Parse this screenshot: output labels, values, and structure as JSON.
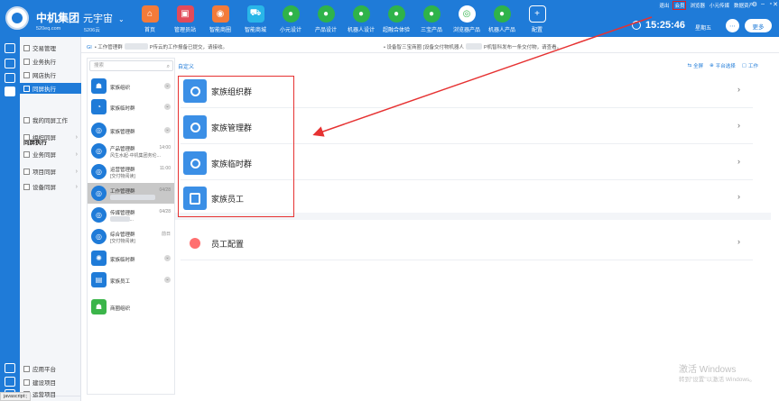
{
  "header": {
    "brand": "中机集团",
    "brand_url": "520eq.com",
    "universe": "元宇宙",
    "universe_sub": "5206云",
    "nav": [
      {
        "label": "首页",
        "icon": "home-icon",
        "color": "#f37b3a",
        "glyph": "⌂"
      },
      {
        "label": "管理员站",
        "icon": "admin-icon",
        "color": "#e24b5a",
        "glyph": "▣"
      },
      {
        "label": "智能商圈",
        "icon": "business-circle-icon",
        "color": "#f37b3a",
        "glyph": "◉"
      },
      {
        "label": "智能商城",
        "icon": "cart-icon",
        "color": "#29b6e8",
        "glyph": "⛟"
      },
      {
        "label": "小元设计",
        "icon": "design-icon",
        "color": "#2fb34a",
        "glyph": "●"
      },
      {
        "label": "产品设计",
        "icon": "product-icon",
        "color": "#2fb34a",
        "glyph": "●"
      },
      {
        "label": "机器人设计",
        "icon": "robot-design-icon",
        "color": "#2fb34a",
        "glyph": "●"
      },
      {
        "label": "超融合体验",
        "icon": "fusion-icon",
        "color": "#2fb34a",
        "glyph": "●"
      },
      {
        "label": "三宝产品",
        "icon": "sanbao-icon",
        "color": "#2fb34a",
        "glyph": "●"
      },
      {
        "label": "浏览器产品",
        "icon": "browser-icon",
        "color": "#ffffff",
        "glyph": "◎"
      },
      {
        "label": "机器人产品",
        "icon": "robot-product-icon",
        "color": "#2fb34a",
        "glyph": "●"
      },
      {
        "label": "配置",
        "icon": "plus-icon",
        "color": "#1f7bd8",
        "glyph": "+"
      }
    ],
    "links": {
      "exit": "退出",
      "vip": "会员",
      "browser": "浏览器",
      "helper": "小元传媒",
      "assets": "数据资产"
    },
    "clock": "15:25:46",
    "weekday": "星期五",
    "more": "更多"
  },
  "leftmenu": {
    "top_items": [
      "交易管理",
      "业务执行",
      "网店执行",
      "同屏执行"
    ],
    "head": "同屏执行",
    "items": [
      {
        "label": "我的同屏工作",
        "arrow": ""
      },
      {
        "label": "组织同屏",
        "arrow": "›"
      },
      {
        "label": "业务同屏",
        "arrow": "›"
      },
      {
        "label": "项目同屏",
        "arrow": "›"
      },
      {
        "label": "设备同屏",
        "arrow": "›"
      }
    ],
    "bottom_items": [
      "应用平台",
      "建设项目",
      "运营项目"
    ]
  },
  "notices": {
    "prefix": "GI",
    "n1a": "• 工作管理群",
    "n1b": "P传云的工作报备已提交，请接收。",
    "n2a": "• 设备智三宝商圈 [设备交付物机器人",
    "n2b": "P机智科发布一条交付物，请查看。"
  },
  "contacts": {
    "search_placeholder": "搜索",
    "items": [
      {
        "name": "家族组织",
        "sub": "",
        "time": "",
        "avatar": "org-icon",
        "glyph": "☗",
        "square": true
      },
      {
        "name": "家族临时群",
        "sub": "",
        "time": "",
        "avatar": "temp-group-icon",
        "glyph": "◔",
        "square": true
      },
      {
        "name": "家族管理群",
        "sub": "",
        "time": "",
        "avatar": "manage-group-icon",
        "glyph": "◎",
        "square": false
      },
      {
        "name": "产品管理群",
        "sub": "风生水起-中机集团务伦...",
        "time": "14:00",
        "avatar": "product-group-icon",
        "glyph": "◎",
        "square": false
      },
      {
        "name": "运营管理群",
        "sub": "[交付物阅读]",
        "time": "11:00",
        "avatar": "ops-group-icon",
        "glyph": "◎",
        "square": false
      },
      {
        "name": "工作管理群",
        "sub": "",
        "time": "04/28",
        "avatar": "work-group-icon",
        "glyph": "◎",
        "square": false
      },
      {
        "name": "传媒管理群",
        "sub": "云(平台交...",
        "time": "04/28",
        "avatar": "media-group-icon",
        "glyph": "◎",
        "square": false
      },
      {
        "name": "综合管理群",
        "sub": "[交付物阅读]",
        "time": "前日",
        "avatar": "general-group-icon",
        "glyph": "◎",
        "square": false
      },
      {
        "name": "家族临时群",
        "sub": "",
        "time": "",
        "avatar": "temp-group-icon",
        "glyph": "✺",
        "square": true
      },
      {
        "name": "家族员工",
        "sub": "",
        "time": "",
        "avatar": "staff-icon",
        "glyph": "▤",
        "square": true
      },
      {
        "name": "商圈组织",
        "sub": "",
        "time": "",
        "avatar": "business-org-icon",
        "glyph": "☗",
        "square": true,
        "green": true
      }
    ]
  },
  "main": {
    "title": "自定义",
    "actions": [
      "全屏",
      "平台选择",
      "工作"
    ],
    "rows": [
      {
        "label": "家族组织群",
        "icon": "family-org-icon"
      },
      {
        "label": "家族管理群",
        "icon": "family-manage-icon"
      },
      {
        "label": "家族临时群",
        "icon": "family-temp-icon"
      },
      {
        "label": "家族员工",
        "icon": "family-staff-icon"
      }
    ],
    "config_label": "员工配置",
    "arrow": "›"
  },
  "watermark": {
    "line1": "激活 Windows",
    "line2": "转到\"设置\"以激活 Windows。"
  },
  "status": "javascript:;",
  "colors": {
    "brand": "#1f7bd8",
    "highlight": "#e63232",
    "row_icon": "#3b8fe6"
  }
}
